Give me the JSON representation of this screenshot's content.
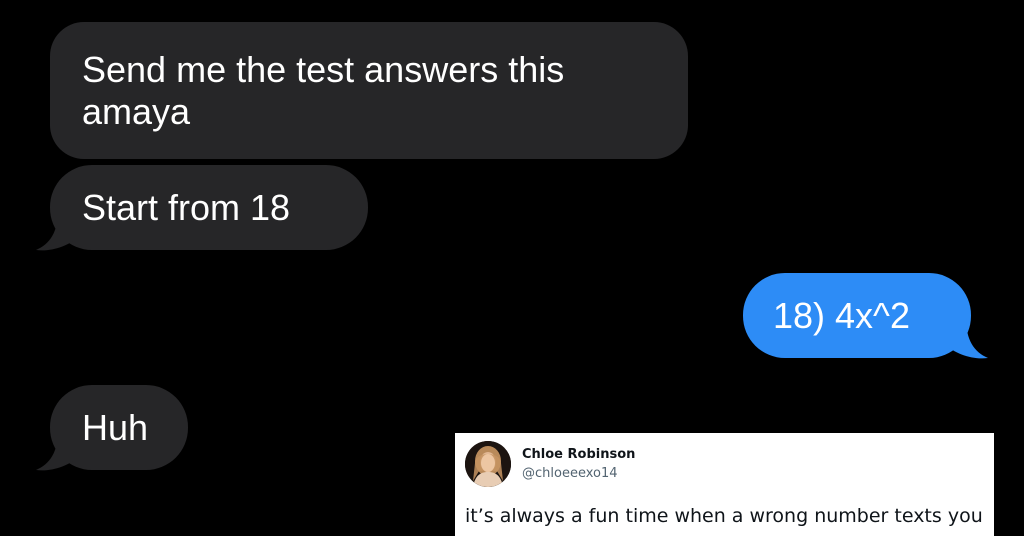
{
  "colors": {
    "background": "#000000",
    "incoming_bubble": "#262628",
    "incoming_text": "#ffffff",
    "outgoing_bubble": "#2d8cf6",
    "outgoing_text": "#ffffff"
  },
  "messages": [
    {
      "direction": "incoming",
      "lines": [
        "Send me the test answers this",
        "amaya"
      ]
    },
    {
      "direction": "incoming",
      "lines": [
        "Start from  18"
      ]
    },
    {
      "direction": "outgoing",
      "lines": [
        "18) 4x^2"
      ]
    },
    {
      "direction": "incoming",
      "lines": [
        "Huh"
      ]
    }
  ],
  "tweet": {
    "avatar_icon": "profile-photo",
    "author_name": "Chloe Robinson",
    "author_handle": "@chloeeexo14",
    "text": "it’s always a fun time when a wrong number texts you"
  }
}
